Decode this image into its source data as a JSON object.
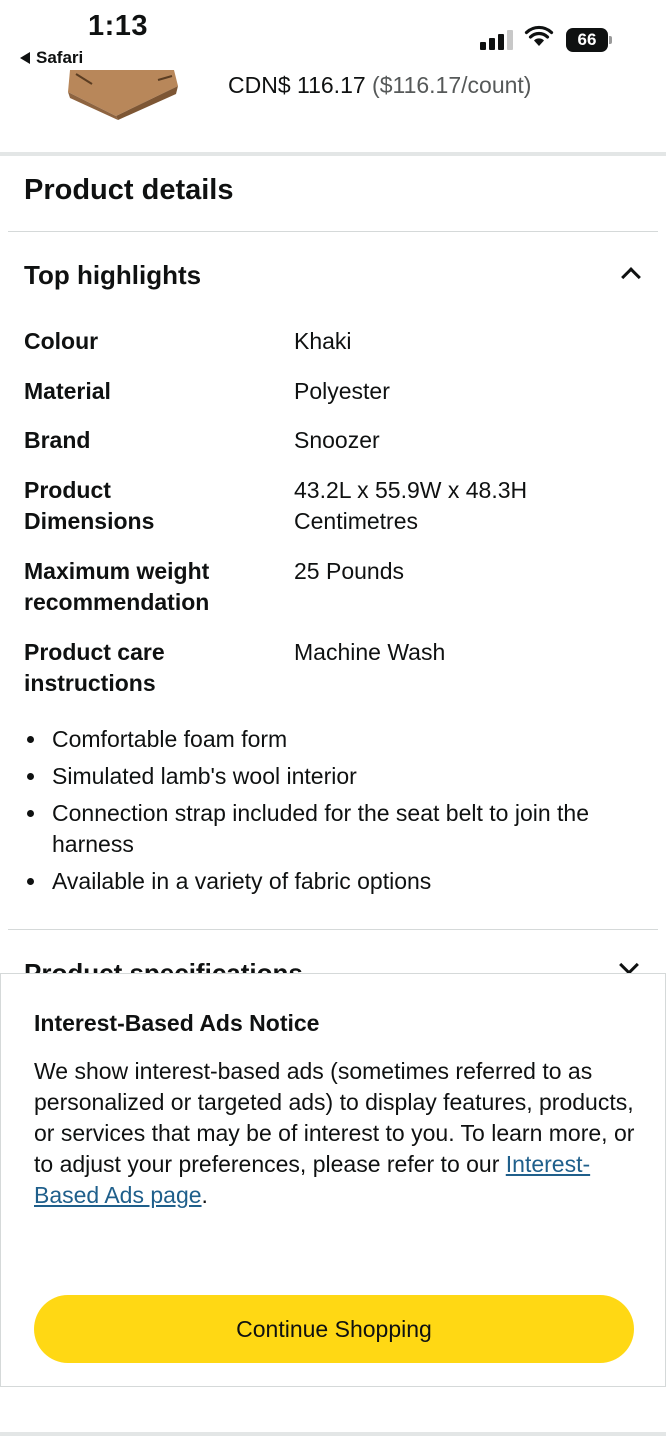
{
  "status_bar": {
    "time": "1:13",
    "back_app": "Safari",
    "battery_level": "66"
  },
  "product": {
    "price": "CDN$ 116.17",
    "unit_price": "($116.17/count)"
  },
  "section": {
    "title": "Product details"
  },
  "highlights": {
    "title": "Top highlights",
    "rows": [
      {
        "label": "Colour",
        "value": "Khaki"
      },
      {
        "label": "Material",
        "value": "Polyester"
      },
      {
        "label": "Brand",
        "value": "Snoozer"
      },
      {
        "label": "Product Dimensions",
        "value": "43.2L x 55.9W x 48.3H Centimetres"
      },
      {
        "label": "Maximum weight recommendation",
        "value": "25 Pounds"
      },
      {
        "label": "Product care instructions",
        "value": "Machine Wash"
      }
    ],
    "bullets": [
      "Comfortable foam form",
      "Simulated lamb's wool interior",
      "Connection strap included for the seat belt to join the harness",
      "Available in a variety of fabric options"
    ]
  },
  "specifications": {
    "title": "Product specifications"
  },
  "modal": {
    "title": "Interest-Based Ads Notice",
    "body_text": "We show interest-based ads (sometimes referred to as personalized or targeted ads) to display features, products, or services that may be of interest to you. To learn more, or to adjust your preferences, please refer to our ",
    "link_text": "Interest-Based Ads page",
    "body_end": ".",
    "button_label": "Continue Shopping"
  },
  "colors": {
    "button_yellow": "#ffd814",
    "link_blue": "#1f5f8b",
    "text_dark": "#0f1111",
    "text_muted": "#565959"
  }
}
